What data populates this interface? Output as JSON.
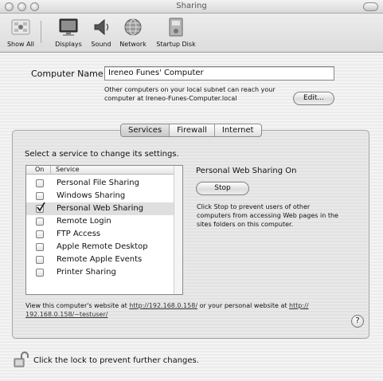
{
  "window": {
    "title": "Sharing"
  },
  "toolbar": {
    "items": [
      {
        "label": "Show All",
        "icon": "apple-grid-icon"
      },
      {
        "label": "Displays",
        "icon": "monitor-icon"
      },
      {
        "label": "Sound",
        "icon": "speaker-icon"
      },
      {
        "label": "Network",
        "icon": "globe-icon"
      },
      {
        "label": "Startup Disk",
        "icon": "disk-icon"
      }
    ]
  },
  "computer": {
    "label": "Computer Name:",
    "name": "Ireneo Funes' Computer",
    "subnet_note_line1": "Other computers on your local subnet can reach your",
    "subnet_note_line2": "computer at Ireneo-Funes-Computer.local",
    "edit_label": "Edit..."
  },
  "tabs": [
    {
      "label": "Services",
      "selected": true
    },
    {
      "label": "Firewall",
      "selected": false
    },
    {
      "label": "Internet",
      "selected": false
    }
  ],
  "services": {
    "prompt": "Select a service to change its settings.",
    "col_on": "On",
    "col_service": "Service",
    "items": [
      {
        "label": "Personal File Sharing",
        "checked": false,
        "selected": false
      },
      {
        "label": "Windows Sharing",
        "checked": false,
        "selected": false
      },
      {
        "label": "Personal Web Sharing",
        "checked": true,
        "selected": true
      },
      {
        "label": "Remote Login",
        "checked": false,
        "selected": false
      },
      {
        "label": "FTP Access",
        "checked": false,
        "selected": false
      },
      {
        "label": "Apple Remote Desktop",
        "checked": false,
        "selected": false
      },
      {
        "label": "Remote Apple Events",
        "checked": false,
        "selected": false
      },
      {
        "label": "Printer Sharing",
        "checked": false,
        "selected": false
      }
    ]
  },
  "detail": {
    "status": "Personal Web Sharing On",
    "button_label": "Stop",
    "desc_line1": "Click Stop to prevent users of other",
    "desc_line2": "computers from accessing Web pages in the",
    "desc_line3": "sites folders on this computer."
  },
  "footer": {
    "view_prefix": "View this computer's website at",
    "site_url": "http://192.168.0.158/",
    "mid_text": "or your personal website at",
    "personal_url_part1": "http://",
    "personal_url_part2": "192.168.0.158/~testuser/",
    "help_label": "?",
    "lock_text": "Click the lock to prevent further changes."
  },
  "colors": {
    "accent": "#3d6fd9",
    "selected_row": "#dfdfdf"
  }
}
